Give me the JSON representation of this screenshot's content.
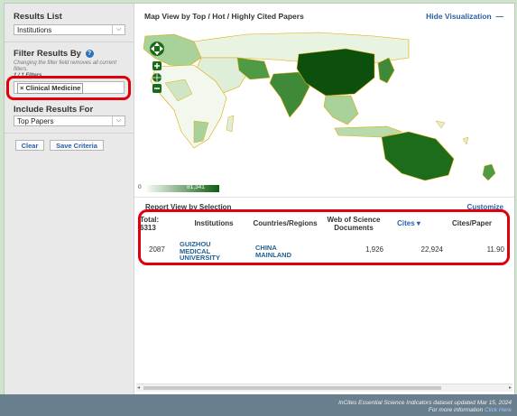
{
  "sidebar": {
    "results_list_title": "Results List",
    "results_list_value": "Institutions",
    "filter_title": "Filter Results By",
    "filter_hint": "Changing the filter field removes all current filters.",
    "filter_count": "1 / 1 Filters",
    "filter_chip": "Clinical Medicine",
    "include_title": "Include Results For",
    "include_value": "Top Papers",
    "clear_label": "Clear",
    "save_label": "Save Criteria"
  },
  "main": {
    "map_title": "Map View by Top / Hot / Highly Cited Papers",
    "hide_viz": "Hide Visualization",
    "legend_min": "0",
    "legend_max": "81,341",
    "report_title": "Report View by Selection",
    "customize": "Customize"
  },
  "table": {
    "total_label": "Total:",
    "total_value": "6313",
    "columns": [
      "Institutions",
      "Countries/Regions",
      "Web of Science Documents",
      "Cites",
      "Cites/Paper"
    ],
    "sort_indicator": "▾",
    "rows": [
      {
        "rank": "2087",
        "institution": "GUIZHOU MEDICAL UNIVERSITY",
        "country": "CHINA MAINLAND",
        "wos_docs": "1,926",
        "cites": "22,924",
        "cites_per_paper": "11.90"
      }
    ]
  },
  "footer": {
    "line1": "InCites Essential Science Indicators dataset updated Mar 15, 2024",
    "line2": "For more information",
    "link": "Click Here"
  },
  "colors": {
    "accent": "#2a5fa5",
    "highlight": "#e0000b",
    "footer": "#6a7f8e"
  }
}
